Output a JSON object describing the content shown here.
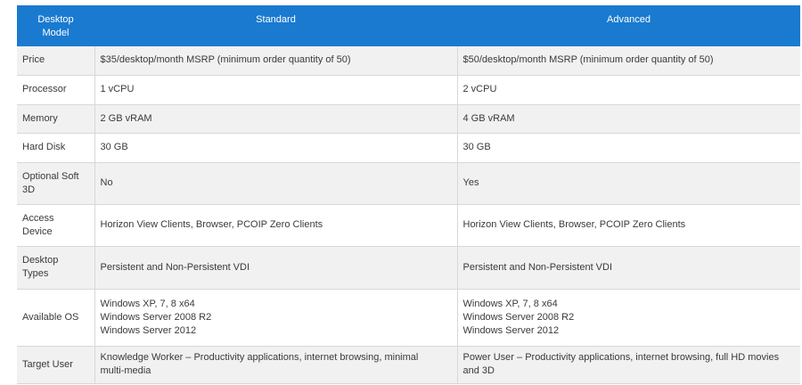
{
  "header": {
    "col0": "Desktop\nModel",
    "col1": "Standard",
    "col2": "Advanced"
  },
  "rows": [
    {
      "label": "Price",
      "standard": "$35/desktop/month MSRP (minimum order quantity of 50)",
      "advanced": "$50/desktop/month MSRP (minimum order quantity of 50)"
    },
    {
      "label": "Processor",
      "standard": "1 vCPU",
      "advanced": "2 vCPU"
    },
    {
      "label": "Memory",
      "standard": "2 GB vRAM",
      "advanced": "4 GB vRAM"
    },
    {
      "label": "Hard Disk",
      "standard": "30 GB",
      "advanced": "30 GB"
    },
    {
      "label": "Optional Soft\n3D",
      "standard": "No",
      "advanced": "Yes"
    },
    {
      "label": "Access\nDevice",
      "standard": "Horizon View Clients, Browser, PCOIP Zero Clients",
      "advanced": "Horizon View Clients, Browser, PCOIP Zero Clients"
    },
    {
      "label": "Desktop\nTypes",
      "standard": "Persistent and Non-Persistent VDI",
      "advanced": "Persistent and Non-Persistent VDI"
    },
    {
      "label": "Available OS",
      "standard": "Windows XP, 7, 8 x64\nWindows Server 2008 R2\nWindows Server 2012",
      "advanced": "Windows XP, 7, 8 x64\nWindows Server 2008 R2\nWindows Server 2012"
    },
    {
      "label": "Target User",
      "standard": "Knowledge Worker – Productivity applications, internet browsing, minimal\nmulti-media",
      "advanced": "Power User – Productivity applications, internet browsing, full HD movies\nand 3D"
    }
  ]
}
